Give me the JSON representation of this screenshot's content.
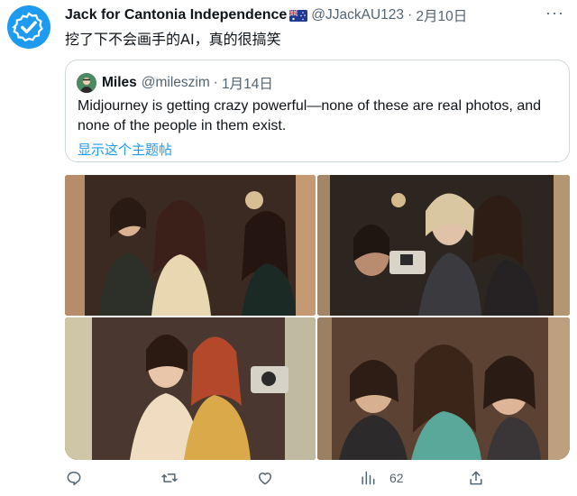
{
  "tweet": {
    "author_name": "Jack for Cantonia Independence",
    "handle": "@JJackAU123",
    "separator": "·",
    "date": "2月10日",
    "text": "挖了下不会画手的AI，真的很搞笑",
    "more_label": "···",
    "flag_icon": "australia-flag-icon",
    "avatar_icon": "verified-badge-icon",
    "accent_color": "#1d9bf0"
  },
  "quoted": {
    "author_name": "Miles",
    "handle": "@mileszim",
    "separator": "·",
    "date": "1月14日",
    "text": "Midjourney is getting crazy powerful—none of these are real photos, and none of the people in them exist.",
    "show_thread": "显示这个主题帖"
  },
  "actions": {
    "reply_icon": "reply-icon",
    "retweet_icon": "retweet-icon",
    "like_icon": "heart-icon",
    "views_icon": "views-icon",
    "views_count": "62",
    "share_icon": "share-icon"
  }
}
